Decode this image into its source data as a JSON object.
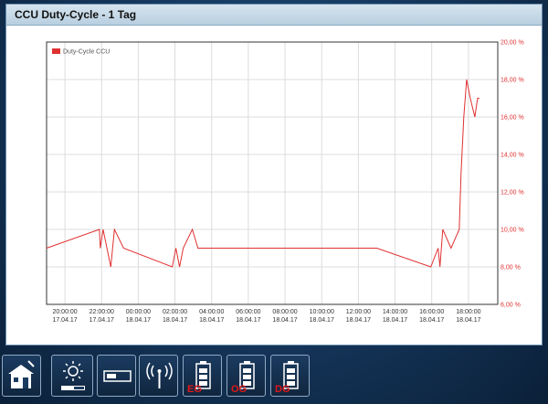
{
  "window": {
    "title": "CCU Duty-Cycle - 1 Tag"
  },
  "chart_data": {
    "type": "line",
    "legend": "Duty-Cycle CCU",
    "legend_position": "top-left",
    "grid": true,
    "ylim": [
      6,
      20
    ],
    "yticks": [
      6,
      8,
      10,
      12,
      14,
      16,
      18,
      20
    ],
    "ytick_labels": [
      "6,00 %",
      "8,00 %",
      "10,00 %",
      "12,00 %",
      "14,00 %",
      "16,00 %",
      "18,00 %",
      "20,00 %"
    ],
    "y_axis_side": "right",
    "xlim": [
      19.0,
      43.6
    ],
    "xticks": [
      {
        "x": 20,
        "line1": "20:00:00",
        "line2": "17.04.17"
      },
      {
        "x": 22,
        "line1": "22:00:00",
        "line2": "17.04.17"
      },
      {
        "x": 24,
        "line1": "00:00:00",
        "line2": "18.04.17"
      },
      {
        "x": 26,
        "line1": "02:00:00",
        "line2": "18.04.17"
      },
      {
        "x": 28,
        "line1": "04:00:00",
        "line2": "18.04.17"
      },
      {
        "x": 30,
        "line1": "06:00:00",
        "line2": "18.04.17"
      },
      {
        "x": 32,
        "line1": "08:00:00",
        "line2": "18.04.17"
      },
      {
        "x": 34,
        "line1": "10:00:00",
        "line2": "18.04.17"
      },
      {
        "x": 36,
        "line1": "12:00:00",
        "line2": "18.04.17"
      },
      {
        "x": 38,
        "line1": "14:00:00",
        "line2": "18.04.17"
      },
      {
        "x": 40,
        "line1": "16:00:00",
        "line2": "18.04.17"
      },
      {
        "x": 42,
        "line1": "18:00:00",
        "line2": "18.04.17"
      }
    ],
    "series": [
      {
        "color": "#e03030",
        "x": [
          19.0,
          21.88,
          21.93,
          22.08,
          22.5,
          22.7,
          23.2,
          25.85,
          26.05,
          26.25,
          26.45,
          26.95,
          27.25,
          27.8,
          33.0,
          37.0,
          39.95,
          40.35,
          40.45,
          40.6,
          41.05,
          41.5,
          41.6,
          41.75,
          41.9,
          42.1,
          42.35,
          42.5,
          42.6
        ],
        "y": [
          9.0,
          10.0,
          9.0,
          10.0,
          8.0,
          10.0,
          9.0,
          8.0,
          9.0,
          8.0,
          9.0,
          10.0,
          9.0,
          9.0,
          9.0,
          9.0,
          8.0,
          9.0,
          8.0,
          10.0,
          9.0,
          10.0,
          13.0,
          16.0,
          18.0,
          17.0,
          16.0,
          17.0,
          17.0
        ]
      }
    ]
  },
  "toolbar": {
    "buttons": [
      {
        "icon": "house-icon",
        "label": ""
      },
      {
        "icon": "sun-icon",
        "label": ""
      },
      {
        "icon": "device-icon",
        "label": ""
      },
      {
        "icon": "antenna-icon",
        "label": ""
      },
      {
        "icon": "battery-icon",
        "label": "EG"
      },
      {
        "icon": "battery-icon",
        "label": "OG"
      },
      {
        "icon": "battery-icon",
        "label": "DG"
      }
    ]
  }
}
